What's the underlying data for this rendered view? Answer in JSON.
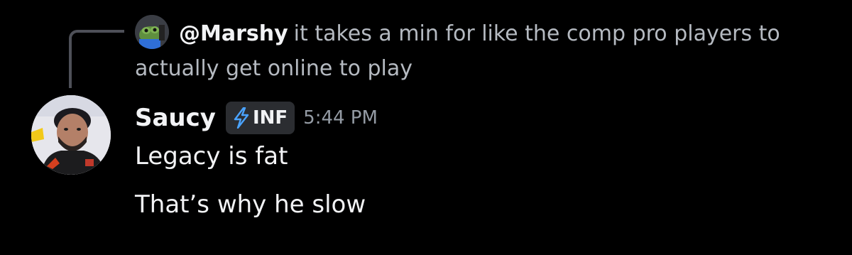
{
  "reply": {
    "author": "@Marshy",
    "text": "it takes a min for like the comp pro players to actually get online to play",
    "avatar_icon": "frog-avatar-icon"
  },
  "message": {
    "author": "Saucy",
    "tag": "INF",
    "tag_icon": "lightning-bolt-icon",
    "timestamp": "5:44 PM",
    "lines": [
      "Legacy is fat",
      "That’s why he slow"
    ]
  },
  "colors": {
    "background": "#000000",
    "text": "#f2f3f5",
    "muted": "#b5bac1",
    "timestamp": "#949ba4",
    "tag_bg": "#2b2d31",
    "bolt": "#4aa3ff"
  }
}
